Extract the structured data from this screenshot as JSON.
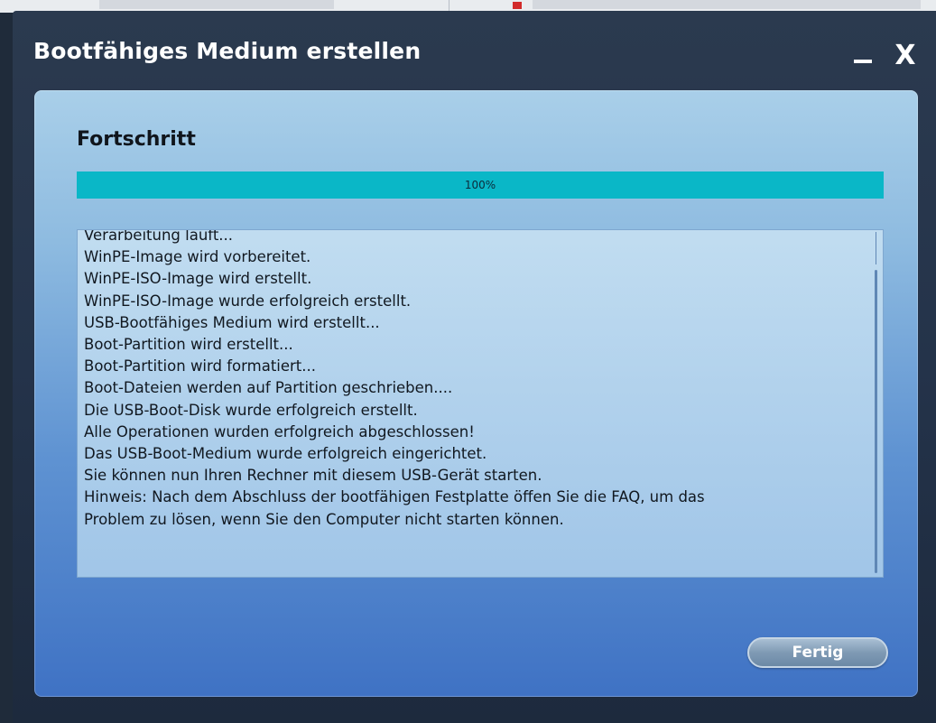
{
  "window": {
    "title": "Bootfähiges Medium erstellen",
    "close_glyph": "X",
    "minimize_icon": "minimize-icon",
    "close_icon": "close-icon"
  },
  "section": {
    "title": "Fortschritt"
  },
  "progress": {
    "value": 1.0,
    "label": "100%",
    "color": "#0ab7c7"
  },
  "log": {
    "lines": [
      "Verarbeitung läuft...",
      "WinPE-Image wird vorbereitet.",
      "WinPE-ISO-Image wird erstellt.",
      "WinPE-ISO-Image wurde erfolgreich erstellt.",
      "USB-Bootfähiges Medium wird erstellt...",
      "Boot-Partition wird erstellt...",
      "Boot-Partition wird formatiert...",
      "Boot-Dateien werden auf Partition geschrieben....",
      "Die USB-Boot-Disk wurde erfolgreich erstellt.",
      "Alle Operationen wurden erfolgreich abgeschlossen!",
      "Das USB-Boot-Medium wurde erfolgreich eingerichtet.",
      "Sie können nun Ihren Rechner mit diesem USB-Gerät starten.",
      "Hinweis: Nach dem Abschluss der bootfähigen Festplatte öffen Sie die FAQ, um das",
      "Problem zu lösen, wenn Sie den Computer nicht starten können."
    ]
  },
  "actions": {
    "finish_label": "Fertig"
  }
}
